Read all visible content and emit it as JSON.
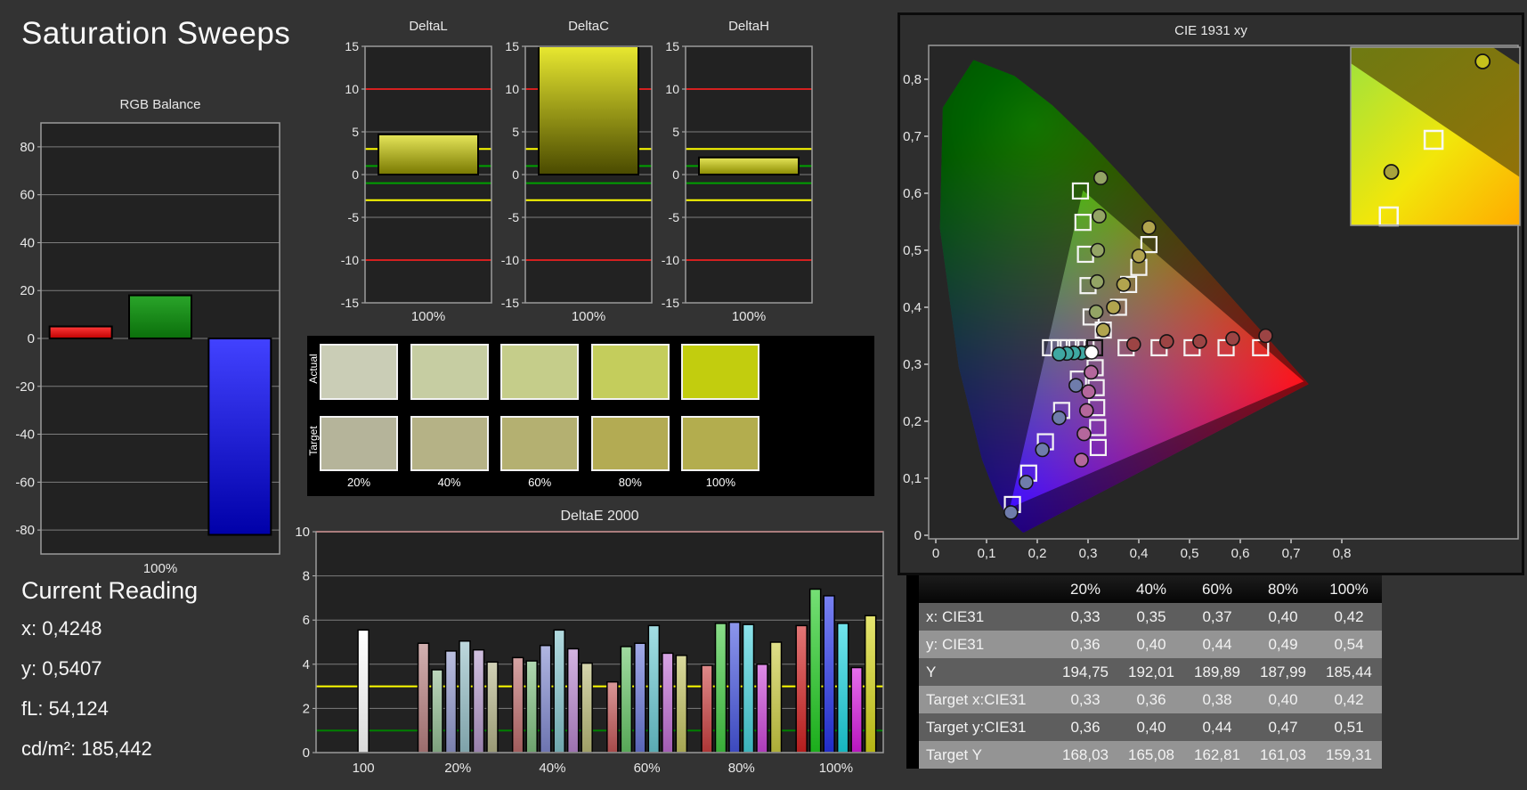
{
  "app": {
    "title": "Saturation Sweeps"
  },
  "current_reading": {
    "title": "Current Reading",
    "readings": [
      "x: 0,4248",
      "y: 0,5407",
      "fL: 54,124",
      "cd/m²: 185,442"
    ]
  },
  "swatches": {
    "row_labels": [
      "Actual",
      "Target"
    ],
    "column_labels": [
      "20%",
      "40%",
      "60%",
      "80%",
      "100%"
    ],
    "actual_colors": [
      "#cacdb6",
      "#c6cda2",
      "#c5cd8a",
      "#c4cd5c",
      "#c2cd0e"
    ],
    "target_colors": [
      "#b5b49a",
      "#b5b286",
      "#b4b071",
      "#b3ab53",
      "#b3ad4e"
    ]
  },
  "measurement_table": {
    "columns": [
      "20%",
      "40%",
      "60%",
      "80%",
      "100%"
    ],
    "rows": [
      {
        "label": "x: CIE31",
        "values": [
          "0,33",
          "0,35",
          "0,37",
          "0,40",
          "0,42"
        ]
      },
      {
        "label": "y: CIE31",
        "values": [
          "0,36",
          "0,40",
          "0,44",
          "0,49",
          "0,54"
        ]
      },
      {
        "label": "Y",
        "values": [
          "194,75",
          "192,01",
          "189,89",
          "187,99",
          "185,44"
        ]
      },
      {
        "label": "Target x:CIE31",
        "values": [
          "0,33",
          "0,36",
          "0,38",
          "0,40",
          "0,42"
        ]
      },
      {
        "label": "Target y:CIE31",
        "values": [
          "0,36",
          "0,40",
          "0,44",
          "0,47",
          "0,51"
        ]
      },
      {
        "label": "Target Y",
        "values": [
          "168,03",
          "165,08",
          "162,81",
          "161,03",
          "159,31"
        ]
      }
    ]
  },
  "chart_data": [
    {
      "type": "bar",
      "title": "RGB Balance",
      "xlabel": "100%",
      "categories": [
        "Red",
        "Green",
        "Blue"
      ],
      "values": [
        5,
        18,
        -82
      ],
      "bar_colors": [
        [
          "#ff3a3a",
          "#c00000"
        ],
        [
          "#2aa52a",
          "#0b6f0b"
        ],
        [
          "#4242ff",
          "#0000a8"
        ]
      ],
      "ylim": [
        -90,
        90
      ],
      "yticks": [
        80,
        60,
        40,
        20,
        0,
        -20,
        -40,
        -60,
        -80
      ],
      "ref_lines": []
    },
    {
      "type": "bar",
      "title": "DeltaL",
      "xlabel": "100%",
      "categories": [
        "100%"
      ],
      "values": [
        4.7
      ],
      "bar_colors": [
        [
          "#e6e65a",
          "#787800"
        ]
      ],
      "ylim": [
        -15,
        15
      ],
      "yticks": [
        15,
        10,
        5,
        0,
        -5,
        -10,
        -15
      ],
      "ref_lines": [
        {
          "value": 10,
          "color": "#d42020"
        },
        {
          "value": -10,
          "color": "#d42020"
        },
        {
          "value": 3,
          "color": "#ffff00"
        },
        {
          "value": -3,
          "color": "#ffff00"
        },
        {
          "value": 1,
          "color": "#00a000"
        },
        {
          "value": -1,
          "color": "#00a000"
        }
      ]
    },
    {
      "type": "bar",
      "title": "DeltaC",
      "xlabel": "100%",
      "categories": [
        "100%"
      ],
      "values": [
        15.4
      ],
      "bar_colors": [
        [
          "#e8e830",
          "#4a4a00"
        ]
      ],
      "ylim": [
        -15,
        15
      ],
      "yticks": [
        15,
        10,
        5,
        0,
        -5,
        -10,
        -15
      ],
      "ref_lines": [
        {
          "value": 10,
          "color": "#d42020"
        },
        {
          "value": -10,
          "color": "#d42020"
        },
        {
          "value": 3,
          "color": "#ffff00"
        },
        {
          "value": -3,
          "color": "#ffff00"
        },
        {
          "value": 1,
          "color": "#00a000"
        },
        {
          "value": -1,
          "color": "#00a000"
        }
      ]
    },
    {
      "type": "bar",
      "title": "DeltaH",
      "xlabel": "100%",
      "categories": [
        "100%"
      ],
      "values": [
        2.0
      ],
      "bar_colors": [
        [
          "#e6e65a",
          "#8a8a00"
        ]
      ],
      "ylim": [
        -15,
        15
      ],
      "yticks": [
        15,
        10,
        5,
        0,
        -5,
        -10,
        -15
      ],
      "ref_lines": [
        {
          "value": 10,
          "color": "#d42020"
        },
        {
          "value": -10,
          "color": "#d42020"
        },
        {
          "value": 3,
          "color": "#ffff00"
        },
        {
          "value": -3,
          "color": "#ffff00"
        },
        {
          "value": 1,
          "color": "#00a000"
        },
        {
          "value": -1,
          "color": "#00a000"
        }
      ]
    },
    {
      "type": "grouped-bar",
      "title": "DeltaE 2000",
      "ylim": [
        0,
        10
      ],
      "yticks": [
        0,
        2,
        4,
        6,
        8,
        10
      ],
      "ref_lines": [
        {
          "value": 10,
          "color": "#d42020"
        },
        {
          "value": 3,
          "color": "#ffff00"
        },
        {
          "value": 1,
          "color": "#008000"
        }
      ],
      "groups": [
        {
          "label": "100",
          "values": [
            5.55
          ],
          "colors": [
            "#ffffff"
          ]
        },
        {
          "label": "20%",
          "values": [
            4.95,
            3.75,
            4.6,
            5.05,
            4.65,
            4.1
          ],
          "colors": [
            "#b67f7f",
            "#93bd93",
            "#9097cb",
            "#94bfc7",
            "#b397c9",
            "#b5b58a"
          ]
        },
        {
          "label": "40%",
          "values": [
            4.3,
            4.15,
            4.85,
            5.55,
            4.7,
            4.05
          ],
          "colors": [
            "#bd6c6c",
            "#7fbf7f",
            "#8089cf",
            "#82c3cc",
            "#b886ce",
            "#baba78"
          ]
        },
        {
          "label": "60%",
          "values": [
            3.2,
            4.8,
            4.95,
            5.75,
            4.5,
            4.4
          ],
          "colors": [
            "#c35757",
            "#66c466",
            "#6876d6",
            "#6ac9d3",
            "#bf6cd3",
            "#c2c261"
          ]
        },
        {
          "label": "80%",
          "values": [
            3.95,
            5.85,
            5.9,
            5.8,
            4.0,
            5.0
          ],
          "colors": [
            "#ca4040",
            "#42ca42",
            "#4656e0",
            "#45d1db",
            "#cb47d9",
            "#cbcb41"
          ]
        },
        {
          "label": "100%",
          "values": [
            5.75,
            7.4,
            7.1,
            5.85,
            3.85,
            6.2
          ],
          "colors": [
            "#d22222",
            "#20cc20",
            "#2634ea",
            "#1ad4e0",
            "#d719df",
            "#d5d518"
          ]
        }
      ]
    },
    {
      "type": "scatter",
      "title": "CIE 1931 xy",
      "xtick_values": [
        0,
        0.1,
        0.2,
        0.3,
        0.4,
        0.5,
        0.6,
        0.7,
        0.8
      ],
      "xtick_labels": [
        "0",
        "0,1",
        "0,2",
        "0,3",
        "0,4",
        "0,5",
        "0,6",
        "0,7",
        "0,8"
      ],
      "ytick_values": [
        0,
        0.1,
        0.2,
        0.3,
        0.4,
        0.5,
        0.6,
        0.7,
        0.8
      ],
      "ytick_labels": [
        "0",
        "0,1",
        "0,2",
        "0,3",
        "0,4",
        "0,5",
        "0,6",
        "0,7",
        "0,8"
      ],
      "gamut_triangle": {
        "red": [
          0.725,
          0.27
        ],
        "green": [
          0.29,
          0.605
        ],
        "blue": [
          0.146,
          0.048
        ]
      },
      "white_point": {
        "target": [
          0.313,
          0.329
        ],
        "measured": [
          0.307,
          0.321
        ]
      },
      "sweeps": {
        "red": {
          "marker_color": "#9c4444",
          "targets": [
            [
              0.375,
              0.329
            ],
            [
              0.44,
              0.329
            ],
            [
              0.505,
              0.329
            ],
            [
              0.572,
              0.329
            ],
            [
              0.64,
              0.329
            ]
          ],
          "measured": [
            [
              0.39,
              0.335
            ],
            [
              0.455,
              0.34
            ],
            [
              0.52,
              0.34
            ],
            [
              0.585,
              0.345
            ],
            [
              0.65,
              0.35
            ]
          ]
        },
        "green": {
          "marker_color": "#93a465",
          "targets": [
            [
              0.306,
              0.383
            ],
            [
              0.3,
              0.438
            ],
            [
              0.295,
              0.493
            ],
            [
              0.29,
              0.549
            ],
            [
              0.285,
              0.604
            ]
          ],
          "measured": [
            [
              0.316,
              0.392
            ],
            [
              0.318,
              0.445
            ],
            [
              0.319,
              0.5
            ],
            [
              0.322,
              0.56
            ],
            [
              0.325,
              0.627
            ]
          ]
        },
        "blue": {
          "marker_color": "#6f7cab",
          "targets": [
            [
              0.281,
              0.274
            ],
            [
              0.248,
              0.219
            ],
            [
              0.216,
              0.164
            ],
            [
              0.183,
              0.109
            ],
            [
              0.151,
              0.054
            ]
          ],
          "measured": [
            [
              0.276,
              0.263
            ],
            [
              0.243,
              0.206
            ],
            [
              0.21,
              0.15
            ],
            [
              0.178,
              0.093
            ],
            [
              0.148,
              0.04
            ]
          ]
        },
        "cyan": {
          "marker_color": "#3fa8a2",
          "targets": [
            [
              0.296,
              0.329
            ],
            [
              0.278,
              0.329
            ],
            [
              0.261,
              0.329
            ],
            [
              0.243,
              0.329
            ],
            [
              0.226,
              0.329
            ]
          ],
          "measured": [
            [
              0.3,
              0.321
            ],
            [
              0.287,
              0.32
            ],
            [
              0.272,
              0.32
            ],
            [
              0.258,
              0.319
            ],
            [
              0.243,
              0.318
            ]
          ]
        },
        "magenta": {
          "marker_color": "#b4679c",
          "targets": [
            [
              0.314,
              0.294
            ],
            [
              0.316,
              0.259
            ],
            [
              0.317,
              0.224
            ],
            [
              0.319,
              0.189
            ],
            [
              0.32,
              0.154
            ]
          ],
          "measured": [
            [
              0.306,
              0.286
            ],
            [
              0.301,
              0.252
            ],
            [
              0.297,
              0.219
            ],
            [
              0.292,
              0.178
            ],
            [
              0.287,
              0.132
            ]
          ]
        },
        "yellow": {
          "marker_color": "#b1a44e",
          "targets": [
            [
              0.33,
              0.36
            ],
            [
              0.36,
              0.4
            ],
            [
              0.38,
              0.44
            ],
            [
              0.4,
              0.47
            ],
            [
              0.42,
              0.51
            ]
          ],
          "measured": [
            [
              0.33,
              0.36
            ],
            [
              0.35,
              0.4
            ],
            [
              0.37,
              0.44
            ],
            [
              0.4,
              0.49
            ],
            [
              0.42,
              0.54
            ]
          ]
        }
      },
      "inset": {
        "markers": [
          {
            "type": "circle",
            "fx": 0.78,
            "fy": 0.08,
            "fill": "#c6c11b"
          },
          {
            "type": "square",
            "fx": 0.49,
            "fy": 0.52
          },
          {
            "type": "circle",
            "fx": 0.24,
            "fy": 0.7,
            "fill": "#a8a33c"
          },
          {
            "type": "square",
            "fx": 0.225,
            "fy": 0.95
          }
        ]
      }
    }
  ]
}
